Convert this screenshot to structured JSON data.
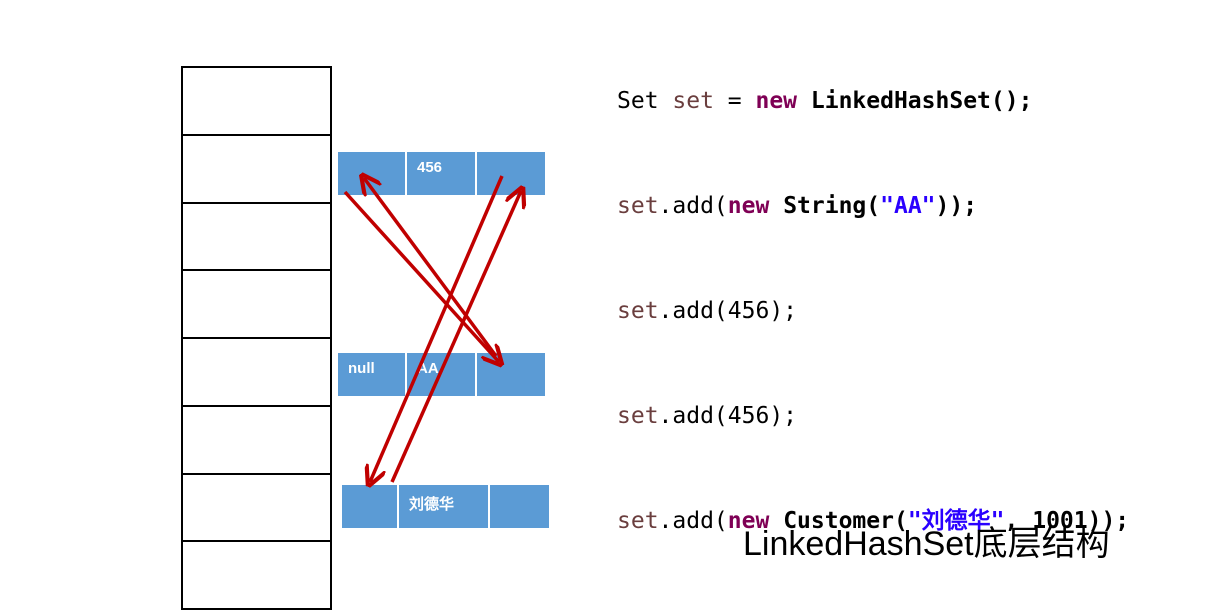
{
  "array": {
    "slot_count": 8
  },
  "nodes": [
    {
      "id": "node-456",
      "cells": [
        "",
        "456",
        ""
      ]
    },
    {
      "id": "node-aa",
      "cells": [
        "null",
        "AA",
        ""
      ]
    },
    {
      "id": "node-ldh",
      "cells": [
        "",
        "刘德华",
        ""
      ]
    }
  ],
  "code": {
    "line1": {
      "t1": "Set ",
      "t2": "set",
      "t3": " = ",
      "t4": "new",
      "t5": " LinkedHashSet();"
    },
    "line2": {
      "t1": "set",
      "t2": ".add(",
      "t3": "new",
      "t4": " String(",
      "t5": "\"AA\"",
      "t6": "));"
    },
    "line3": {
      "t1": "set",
      "t2": ".add(456);"
    },
    "line4": {
      "t1": "set",
      "t2": ".add(456);"
    },
    "line5": {
      "t1": "set",
      "t2": ".add(",
      "t3": "new",
      "t4": " Customer(",
      "t5": "\"刘德华\"",
      "t6": ", 1001));"
    }
  },
  "caption": "LinkedHashSet底层结构",
  "colors": {
    "node_fill": "#5b9bd5",
    "arrow": "#c00000",
    "keyword": "#7f0055",
    "string": "#2a00ff"
  }
}
